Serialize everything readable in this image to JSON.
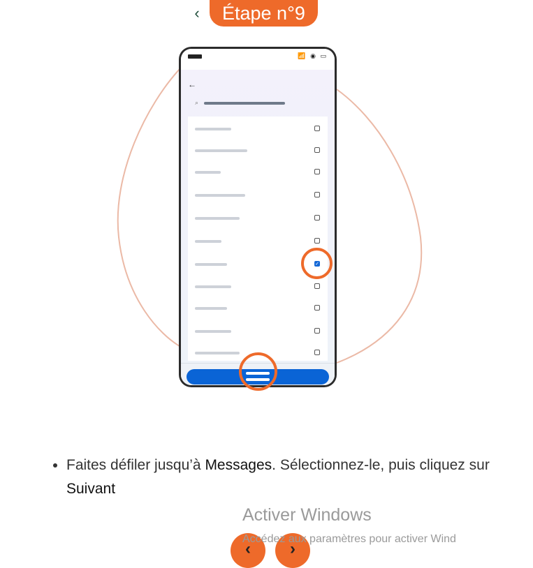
{
  "header": {
    "back_glyph": "‹",
    "step_label": "Étape n°9"
  },
  "phone": {
    "status_icons": "📶 ◉ ▭",
    "back_glyph": "←",
    "search_glyph": "⌕",
    "check_glyph": "✓",
    "items": [
      {
        "checked": false
      },
      {
        "checked": false
      },
      {
        "checked": false
      },
      {
        "checked": false
      },
      {
        "checked": false
      },
      {
        "checked": false
      },
      {
        "checked": true
      },
      {
        "checked": false
      },
      {
        "checked": false
      },
      {
        "checked": false
      },
      {
        "checked": false
      }
    ]
  },
  "instruction": {
    "part1": "Faites défiler jusqu’à ",
    "messages": "Messages",
    "part2": ". Sélectionnez-le, puis cliquez sur ",
    "next": "Suivant"
  },
  "watermark": {
    "title": "Activer Windows",
    "subtitle": "Accédez aux paramètres pour activer Wind"
  },
  "nav": {
    "prev_glyph": "‹",
    "next_glyph": "›"
  },
  "colors": {
    "accent": "#ee6a2a",
    "primary_button": "#0a64d6",
    "checked": "#1468d6"
  }
}
